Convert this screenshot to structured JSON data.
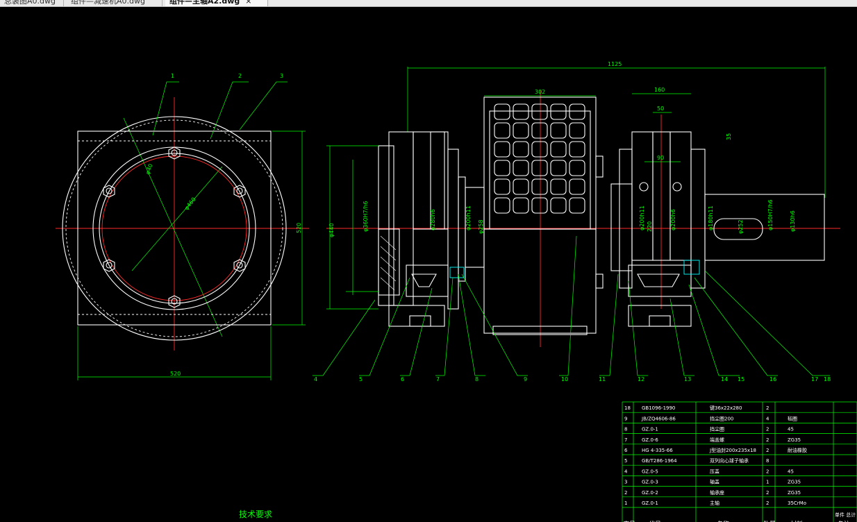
{
  "tabs": [
    {
      "label": "总装图A0.dwg",
      "active": false
    },
    {
      "label": "组件—减速机A0.dwg",
      "active": false
    },
    {
      "label": "组件—主轴A2.dwg",
      "active": true
    }
  ],
  "tab_close_glyph": "×",
  "colors": {
    "background": "#000000",
    "geometry": "#ffffff",
    "dimension": "#00ff00",
    "centerline": "#ff2a2a",
    "section": "#00ffff"
  },
  "left_view": {
    "balloons": [
      "1",
      "2",
      "3"
    ],
    "dims": {
      "width": "520",
      "height": "520",
      "pcd": "φ460",
      "bore": "φ40"
    }
  },
  "right_view": {
    "dims": {
      "overall": "1125",
      "drum": "302",
      "hub": "160",
      "key": "50",
      "bolt": "90",
      "flange_t": "35",
      "h": "220",
      "d1": "φ440",
      "d2": "φ360H7/h6",
      "d3": "φ280h6",
      "d4": "φ200h11",
      "d5": "φ258",
      "d6": "φ200h11",
      "d7": "φ200h6",
      "d8": "φ180h11",
      "d9": "φ252",
      "d10": "φ150H7/h6",
      "d11": "φ130h6"
    },
    "balloons": [
      "4",
      "5",
      "6",
      "7",
      "8",
      "9",
      "10",
      "11",
      "12",
      "13",
      "14",
      "15",
      "16",
      "17",
      "18"
    ]
  },
  "tech_req_title": "技术要求",
  "bom": {
    "rows": [
      {
        "no": "18",
        "code": "GB1096-1990",
        "name": "键36x22x280",
        "qty": "2",
        "material": ""
      },
      {
        "no": "9",
        "code": "JB/ZQ4606-86",
        "name": "挡尘圈200",
        "qty": "4",
        "material": "毡圈"
      },
      {
        "no": "8",
        "code": "GZ.0-1",
        "name": "挡尘圈",
        "qty": "2",
        "material": "45"
      },
      {
        "no": "7",
        "code": "GZ.0-6",
        "name": "端盖螺",
        "qty": "2",
        "material": "ZG35"
      },
      {
        "no": "6",
        "code": "HG 4-335-66",
        "name": "J型油封200x235x18",
        "qty": "2",
        "material": "耐油橡胶"
      },
      {
        "no": "5",
        "code": "GB/T286-1964",
        "name": "双列向心球子轴承",
        "qty": "8",
        "material": ""
      },
      {
        "no": "4",
        "code": "GZ.0-5",
        "name": "压盖",
        "qty": "2",
        "material": "45"
      },
      {
        "no": "3",
        "code": "GZ.0-3",
        "name": "轴盖",
        "qty": "1",
        "material": "ZG35"
      },
      {
        "no": "2",
        "code": "GZ.0-2",
        "name": "轴承座",
        "qty": "2",
        "material": "ZG35"
      },
      {
        "no": "1",
        "code": "GZ.0-1",
        "name": "主轴",
        "qty": "2",
        "material": "35CrMo"
      }
    ],
    "header": {
      "no": "序号",
      "code": "代号",
      "name": "名称",
      "qty": "数量",
      "material": "材料",
      "note": "备注"
    },
    "side_note": "单件 总计"
  }
}
